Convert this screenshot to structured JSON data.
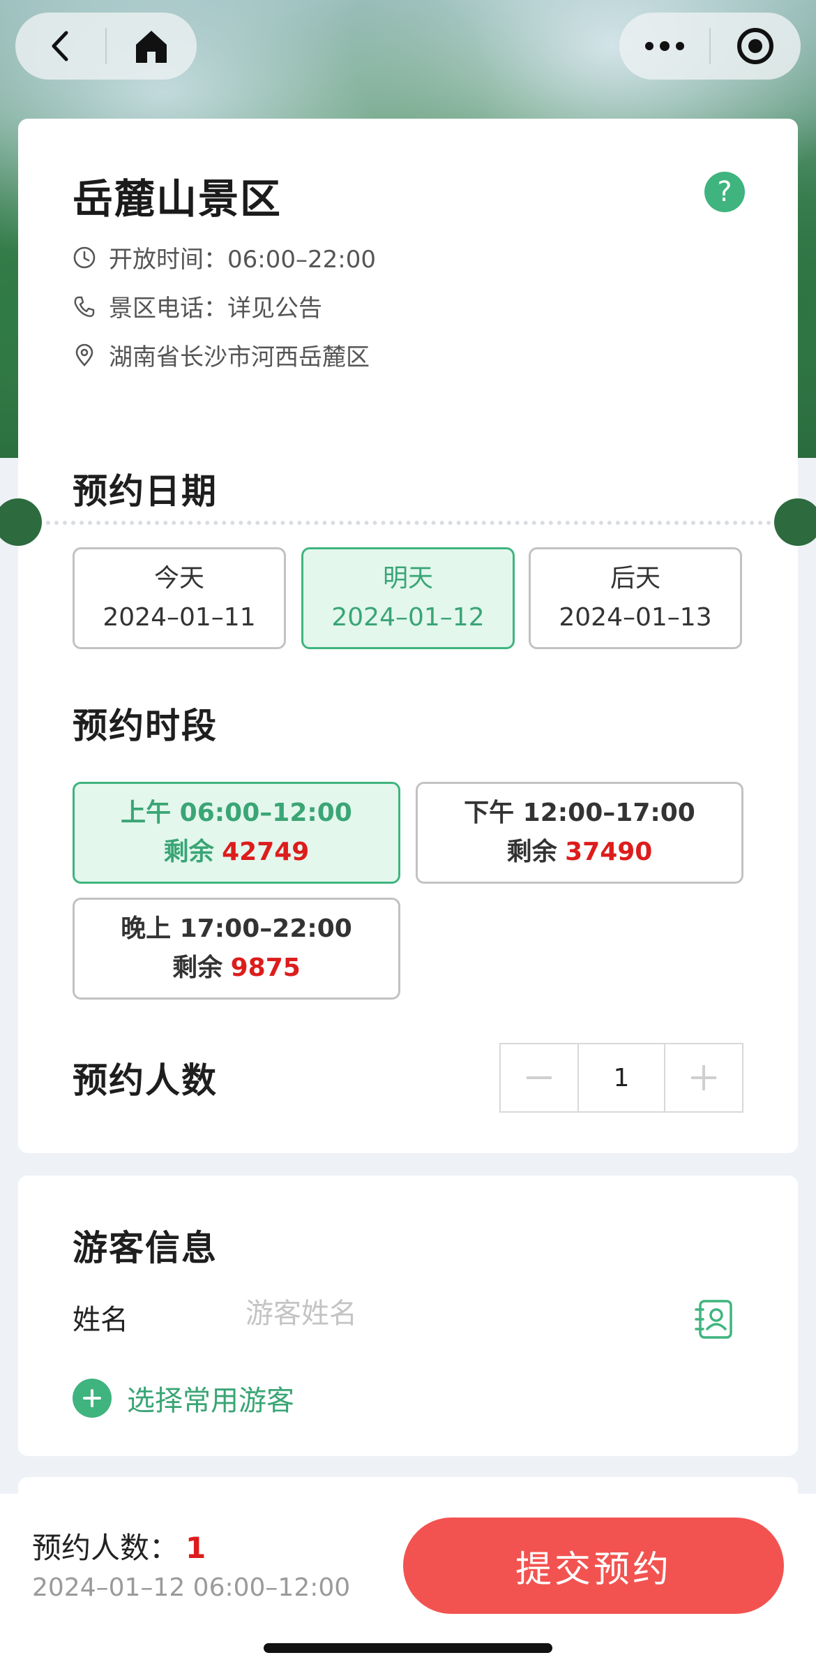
{
  "scenic": {
    "name": "岳麓山景区",
    "hours": "开放时间：06:00–22:00",
    "phone": "景区电话：详见公告",
    "address": "湖南省长沙市河西岳麓区"
  },
  "date_section": {
    "title": "预约日期",
    "options": [
      {
        "label": "今天",
        "date": "2024–01–11",
        "selected": false
      },
      {
        "label": "明天",
        "date": "2024–01–12",
        "selected": true
      },
      {
        "label": "后天",
        "date": "2024–01–13",
        "selected": false
      }
    ]
  },
  "slot_section": {
    "title": "预约时段",
    "remain_label": "剩余",
    "slots": [
      {
        "label": "上午 06:00–12:00",
        "remain": "42749",
        "selected": true
      },
      {
        "label": "下午 12:00–17:00",
        "remain": "37490",
        "selected": false
      },
      {
        "label": "晚上 17:00–22:00",
        "remain": "9875",
        "selected": false
      }
    ]
  },
  "people_section": {
    "title": "预约人数",
    "value": "1"
  },
  "visitor_section": {
    "title": "游客信息",
    "name_label": "姓名",
    "name_placeholder": "游客姓名",
    "choose_label": "选择常用游客"
  },
  "bottom": {
    "count_label": "预约人数：",
    "count_value": "1",
    "selected_time": "2024–01–12 06:00–12:00",
    "submit_label": "提交预约"
  },
  "colors": {
    "accent_green": "#3fb47e",
    "selected_bg": "#e3f7ed",
    "remain_red": "#dd1c1c",
    "submit_red": "#f25350"
  }
}
